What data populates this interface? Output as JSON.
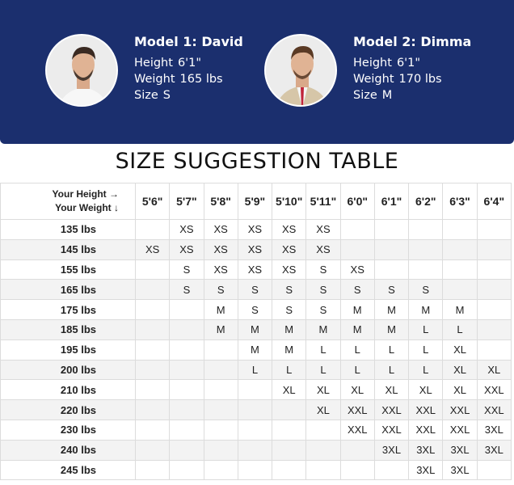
{
  "models": [
    {
      "name": "Model 1: David",
      "height_label": "Height",
      "height": "6'1\"",
      "weight_label": "Weight",
      "weight": "165 lbs",
      "size_label": "Size",
      "size": "S"
    },
    {
      "name": "Model 2: Dimma",
      "height_label": "Height",
      "height": "6'1\"",
      "weight_label": "Weight",
      "weight": "170 lbs",
      "size_label": "Size",
      "size": "M"
    }
  ],
  "title": "SIZE SUGGESTION TABLE",
  "header": {
    "height_axis": "Your Height →",
    "weight_axis": "Your Weight ↓"
  },
  "heights": [
    "5'6\"",
    "5'7\"",
    "5'8\"",
    "5'9\"",
    "5'10\"",
    "5'11\"",
    "6'0\"",
    "6'1\"",
    "6'2\"",
    "6'3\"",
    "6'4\""
  ],
  "rows": [
    {
      "weight": "135 lbs",
      "sizes": [
        "",
        "XS",
        "XS",
        "XS",
        "XS",
        "XS",
        "",
        "",
        "",
        "",
        ""
      ]
    },
    {
      "weight": "145 lbs",
      "sizes": [
        "XS",
        "XS",
        "XS",
        "XS",
        "XS",
        "XS",
        "",
        "",
        "",
        "",
        ""
      ]
    },
    {
      "weight": "155 lbs",
      "sizes": [
        "",
        "S",
        "XS",
        "XS",
        "XS",
        "S",
        "XS",
        "",
        "",
        "",
        ""
      ]
    },
    {
      "weight": "165 lbs",
      "sizes": [
        "",
        "S",
        "S",
        "S",
        "S",
        "S",
        "S",
        "S",
        "S",
        "",
        ""
      ]
    },
    {
      "weight": "175 lbs",
      "sizes": [
        "",
        "",
        "M",
        "S",
        "S",
        "S",
        "M",
        "M",
        "M",
        "M",
        ""
      ]
    },
    {
      "weight": "185 lbs",
      "sizes": [
        "",
        "",
        "M",
        "M",
        "M",
        "M",
        "M",
        "M",
        "L",
        "L",
        ""
      ]
    },
    {
      "weight": "195 lbs",
      "sizes": [
        "",
        "",
        "",
        "M",
        "M",
        "L",
        "L",
        "L",
        "L",
        "XL",
        ""
      ]
    },
    {
      "weight": "200 lbs",
      "sizes": [
        "",
        "",
        "",
        "L",
        "L",
        "L",
        "L",
        "L",
        "L",
        "XL",
        "XL"
      ]
    },
    {
      "weight": "210 lbs",
      "sizes": [
        "",
        "",
        "",
        "",
        "XL",
        "XL",
        "XL",
        "XL",
        "XL",
        "XL",
        "XXL"
      ]
    },
    {
      "weight": "220 lbs",
      "sizes": [
        "",
        "",
        "",
        "",
        "",
        "XL",
        "XXL",
        "XXL",
        "XXL",
        "XXL",
        "XXL"
      ]
    },
    {
      "weight": "230 lbs",
      "sizes": [
        "",
        "",
        "",
        "",
        "",
        "",
        "XXL",
        "XXL",
        "XXL",
        "XXL",
        "3XL"
      ]
    },
    {
      "weight": "240 lbs",
      "sizes": [
        "",
        "",
        "",
        "",
        "",
        "",
        "",
        "3XL",
        "3XL",
        "3XL",
        "3XL"
      ]
    },
    {
      "weight": "245 lbs",
      "sizes": [
        "",
        "",
        "",
        "",
        "",
        "",
        "",
        "",
        "3XL",
        "3XL",
        ""
      ]
    }
  ]
}
